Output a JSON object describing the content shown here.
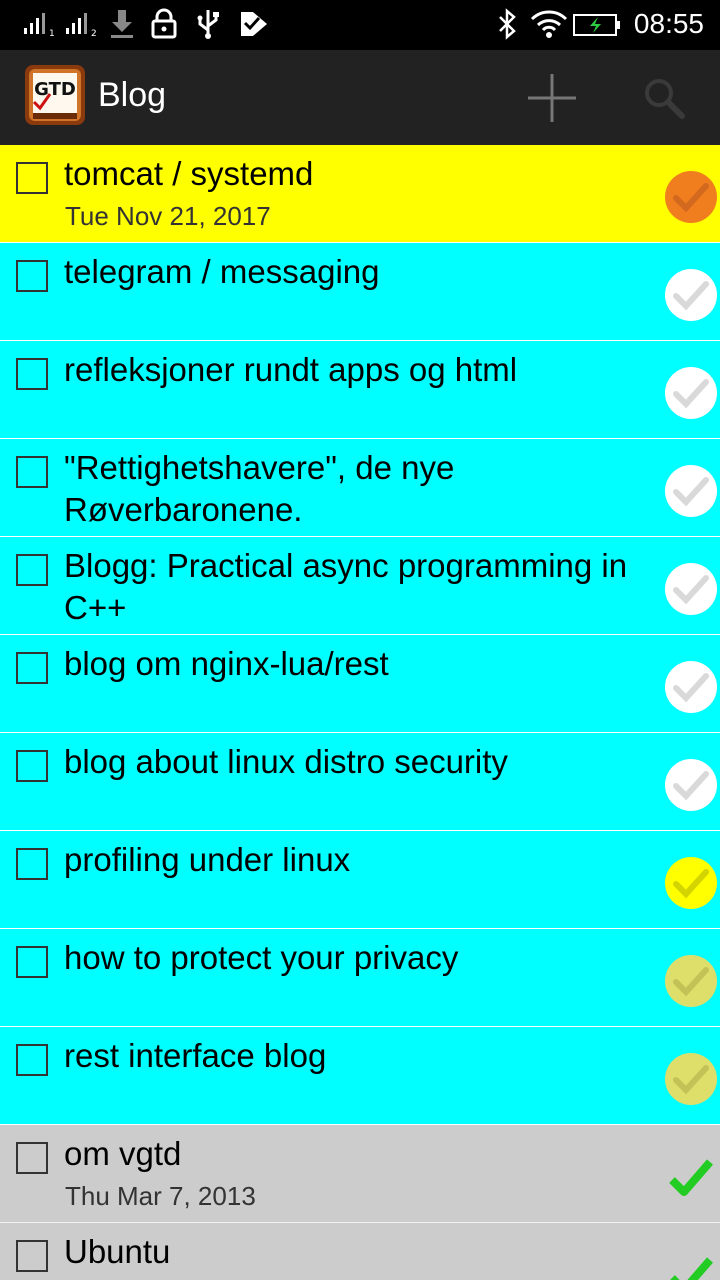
{
  "status_bar": {
    "time": "08:55"
  },
  "action_bar": {
    "logo_text": "GTD",
    "title": "Blog",
    "add_icon": "plus-icon",
    "search_icon": "search-icon"
  },
  "colors": {
    "highlight_yellow": "#ffff00",
    "active_cyan": "#00ffff",
    "done_gray": "#cccccc",
    "orange_priority": "#f07d1e",
    "yellow_priority": "#ffff00",
    "olive_priority": "#dede6b",
    "white_priority": "#ffffff",
    "green_check": "#22cc22"
  },
  "tasks": [
    {
      "title": "tomcat / systemd",
      "date": "Tue Nov 21, 2017",
      "background": "#ffff00",
      "status_icon": "orange-check-circle-icon",
      "circle_color": "#f07d1e",
      "check_color": "#d2691e"
    },
    {
      "title": "telegram / messaging",
      "date": "",
      "background": "#00ffff",
      "status_icon": "white-check-circle-icon",
      "circle_color": "#ffffff",
      "check_color": "#d9d9d9"
    },
    {
      "title": "refleksjoner rundt apps og html",
      "date": "",
      "background": "#00ffff",
      "status_icon": "white-check-circle-icon",
      "circle_color": "#ffffff",
      "check_color": "#d9d9d9"
    },
    {
      "title": "\"Rettighetshavere\", de nye Røverbaronene.",
      "date": "",
      "background": "#00ffff",
      "status_icon": "white-check-circle-icon",
      "circle_color": "#ffffff",
      "check_color": "#d9d9d9"
    },
    {
      "title": "Blogg: Practical async programming in C++",
      "date": "",
      "background": "#00ffff",
      "status_icon": "white-check-circle-icon",
      "circle_color": "#ffffff",
      "check_color": "#d9d9d9"
    },
    {
      "title": "blog om nginx-lua/rest",
      "date": "",
      "background": "#00ffff",
      "status_icon": "white-check-circle-icon",
      "circle_color": "#ffffff",
      "check_color": "#d9d9d9"
    },
    {
      "title": "blog about linux distro security",
      "date": "",
      "background": "#00ffff",
      "status_icon": "white-check-circle-icon",
      "circle_color": "#ffffff",
      "check_color": "#d9d9d9"
    },
    {
      "title": "profiling under linux",
      "date": "",
      "background": "#00ffff",
      "status_icon": "yellow-check-circle-icon",
      "circle_color": "#ffff00",
      "check_color": "#d4d400"
    },
    {
      "title": "how to protect your privacy",
      "date": "",
      "background": "#00ffff",
      "status_icon": "olive-check-circle-icon",
      "circle_color": "#dede6b",
      "check_color": "#c2c257"
    },
    {
      "title": "rest interface blog",
      "date": "",
      "background": "#00ffff",
      "status_icon": "olive-check-circle-icon",
      "circle_color": "#dede6b",
      "check_color": "#c2c257"
    },
    {
      "title": "om vgtd",
      "date": "Thu Mar 7, 2013",
      "background": "#cccccc",
      "status_icon": "green-check-icon",
      "circle_color": "",
      "check_color": "#22cc22"
    },
    {
      "title": "Ubuntu",
      "date": "",
      "background": "#cccccc",
      "status_icon": "green-check-icon",
      "circle_color": "",
      "check_color": "#22cc22"
    }
  ]
}
